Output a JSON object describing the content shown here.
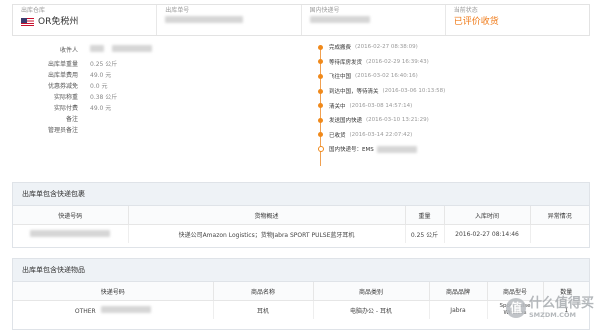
{
  "header": {
    "warehouse_label": "出库仓库",
    "warehouse_value": "OR免税州",
    "order_no_label": "出库单号",
    "domestic_no_label": "国内快递号",
    "status_label": "当前状态",
    "status_value": "已评价收货"
  },
  "info": {
    "rows": [
      {
        "label": "收件人",
        "value": ""
      },
      {
        "label": "出库单重量",
        "value": "0.25 公斤"
      },
      {
        "label": "出库单费用",
        "value": "49.0 元"
      },
      {
        "label": "优惠券减免",
        "value": "0.0 元"
      },
      {
        "label": "实际称重",
        "value": "0.38 公斤"
      },
      {
        "label": "实际付费",
        "value": "49.0 元"
      },
      {
        "label": "备注",
        "value": ""
      },
      {
        "label": "管理员备注",
        "value": ""
      }
    ]
  },
  "timeline": [
    {
      "event": "完成搬费",
      "time": "(2016-02-27 08:38:09)"
    },
    {
      "event": "等待库房发货",
      "time": "(2016-02-29 16:39:43)"
    },
    {
      "event": "飞往中国",
      "time": "(2016-03-02 16:40:16)"
    },
    {
      "event": "到达中国，等待清关",
      "time": "(2016-03-06 10:13:58)"
    },
    {
      "event": "清关中",
      "time": "(2016-03-08 14:57:14)"
    },
    {
      "event": "发送国内快递",
      "time": "(2016-03-10 13:21:29)"
    },
    {
      "event": "已收货",
      "time": "(2016-03-14 22:07:42)"
    },
    {
      "event": "国内快递号：EMS",
      "time": ""
    }
  ],
  "packages": {
    "title": "出库单包含快递包裹",
    "columns": [
      "快递号码",
      "货物概述",
      "重量",
      "入库时间",
      "异常情况"
    ],
    "rows": [
      {
        "tracking": "",
        "desc": "快递公司Amazon Logistics；货物Jabra SPORT PULSE蓝牙耳机",
        "weight": "0.25 公斤",
        "time": "2016-02-27 08:14:46",
        "issue": ""
      }
    ]
  },
  "items": {
    "title": "出库单包含快递物品",
    "columns": [
      "快递号码",
      "商品名称",
      "商品类别",
      "商品品牌",
      "商品型号",
      "数量"
    ],
    "rows": [
      {
        "tracking": "OTHER",
        "name": "耳机",
        "category": "电脑办公 - 耳机",
        "brand": "Jabra",
        "model": "Sport Pulse Wireless",
        "qty": "1"
      }
    ]
  },
  "watermark": {
    "logo": "值",
    "text": "什么值得买",
    "sub": "SMZDM.COM"
  }
}
